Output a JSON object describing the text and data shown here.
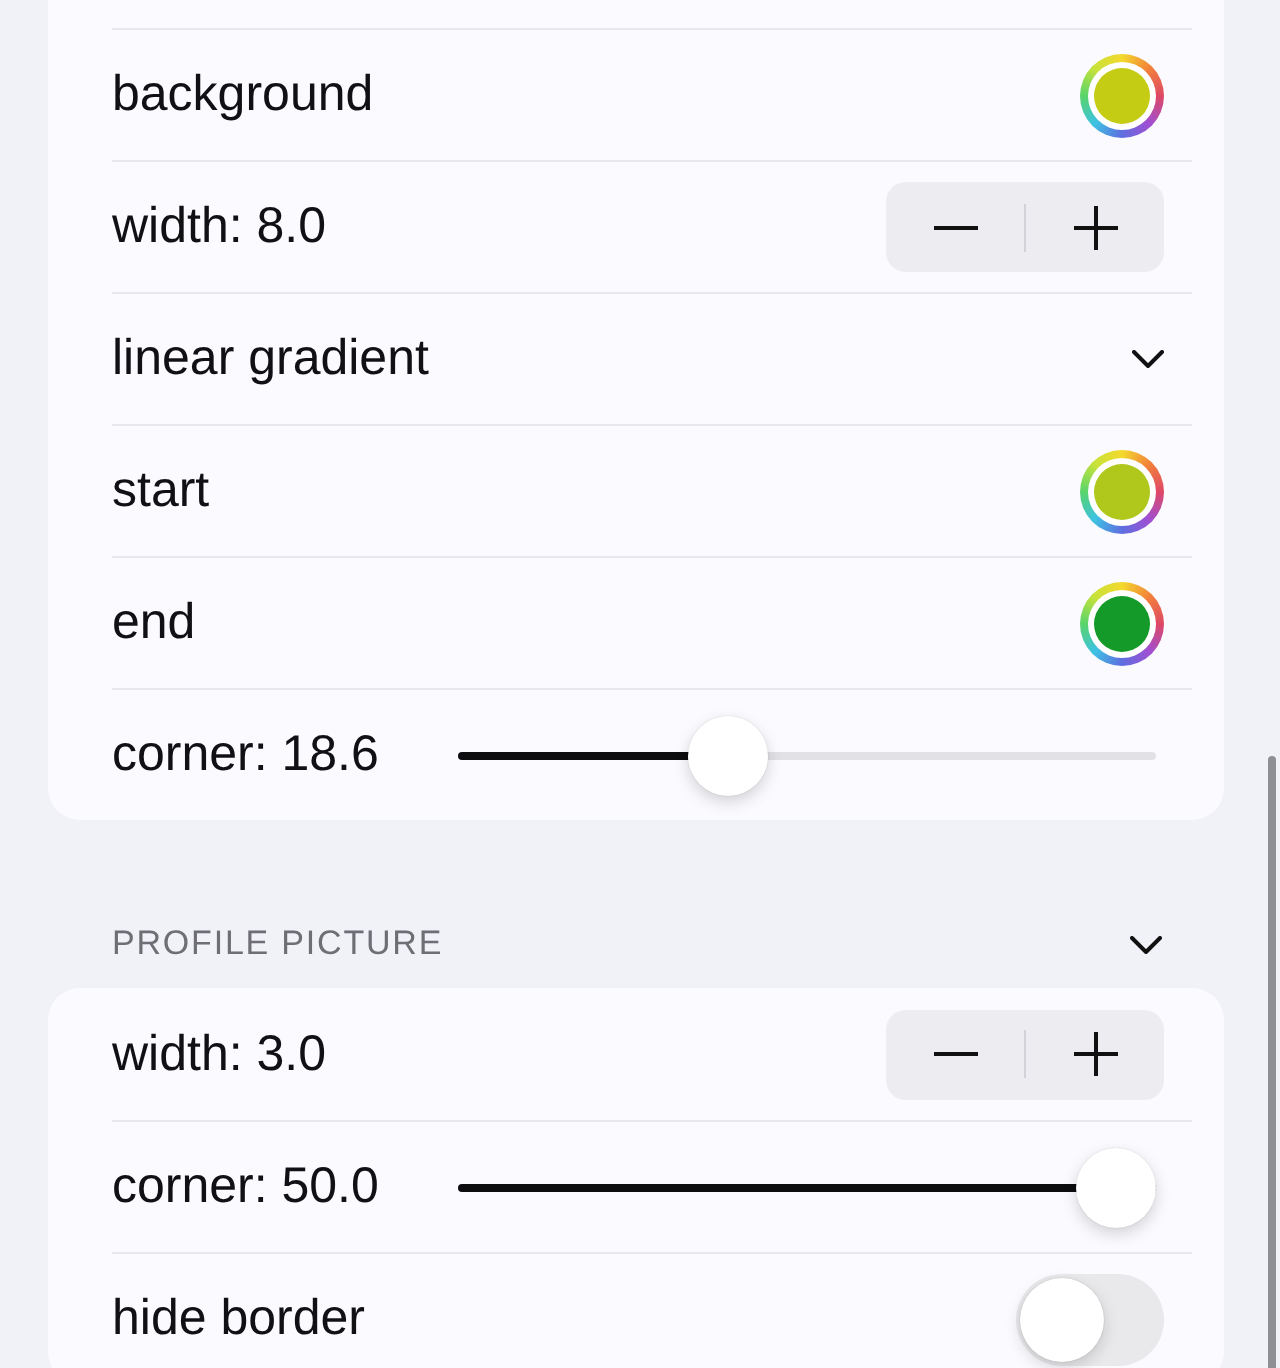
{
  "sections": [
    {
      "rows": [
        {
          "kind": "color",
          "label": "background",
          "color": "#c4cc14"
        },
        {
          "kind": "stepper",
          "label": "width: 8.0"
        },
        {
          "kind": "menu",
          "label": "linear gradient"
        },
        {
          "kind": "color",
          "label": "start",
          "color": "#b0c71c"
        },
        {
          "kind": "color",
          "label": "end",
          "color": "#149a28"
        },
        {
          "kind": "slider",
          "label": "corner: 18.6",
          "level": 0.37
        }
      ]
    },
    {
      "header": "PROFILE PICTURE",
      "rows": [
        {
          "kind": "stepper",
          "label": "width: 3.0"
        },
        {
          "kind": "slider",
          "label": "corner: 50.0",
          "level": 1
        },
        {
          "kind": "toggle",
          "label": "hide border",
          "on": false
        }
      ]
    }
  ]
}
